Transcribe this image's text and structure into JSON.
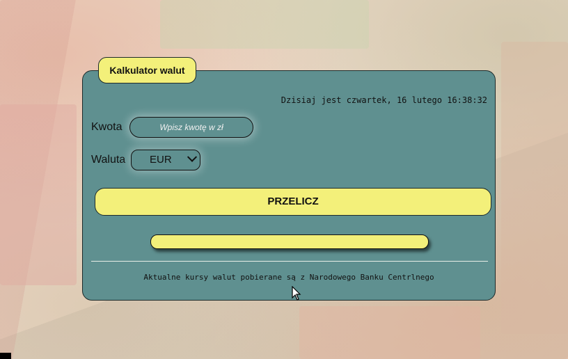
{
  "app": {
    "title": "Kalkulator walut",
    "datetime_text": "Dzisiaj jest czwartek, 16 lutego 16:38:32"
  },
  "form": {
    "amount_label": "Kwota",
    "amount_placeholder": "Wpisz kwotę w zł",
    "amount_value": "",
    "currency_label": "Waluta",
    "currency_selected": "EUR",
    "convert_label": "PRZELICZ",
    "result_text": ""
  },
  "footer": {
    "note": "Aktualne kursy walut pobierane są z Narodowego Banku Centrlnego"
  },
  "colors": {
    "panel": "#5f9090",
    "accent_yellow": "#f3f07a",
    "border": "#1d2a2a"
  }
}
